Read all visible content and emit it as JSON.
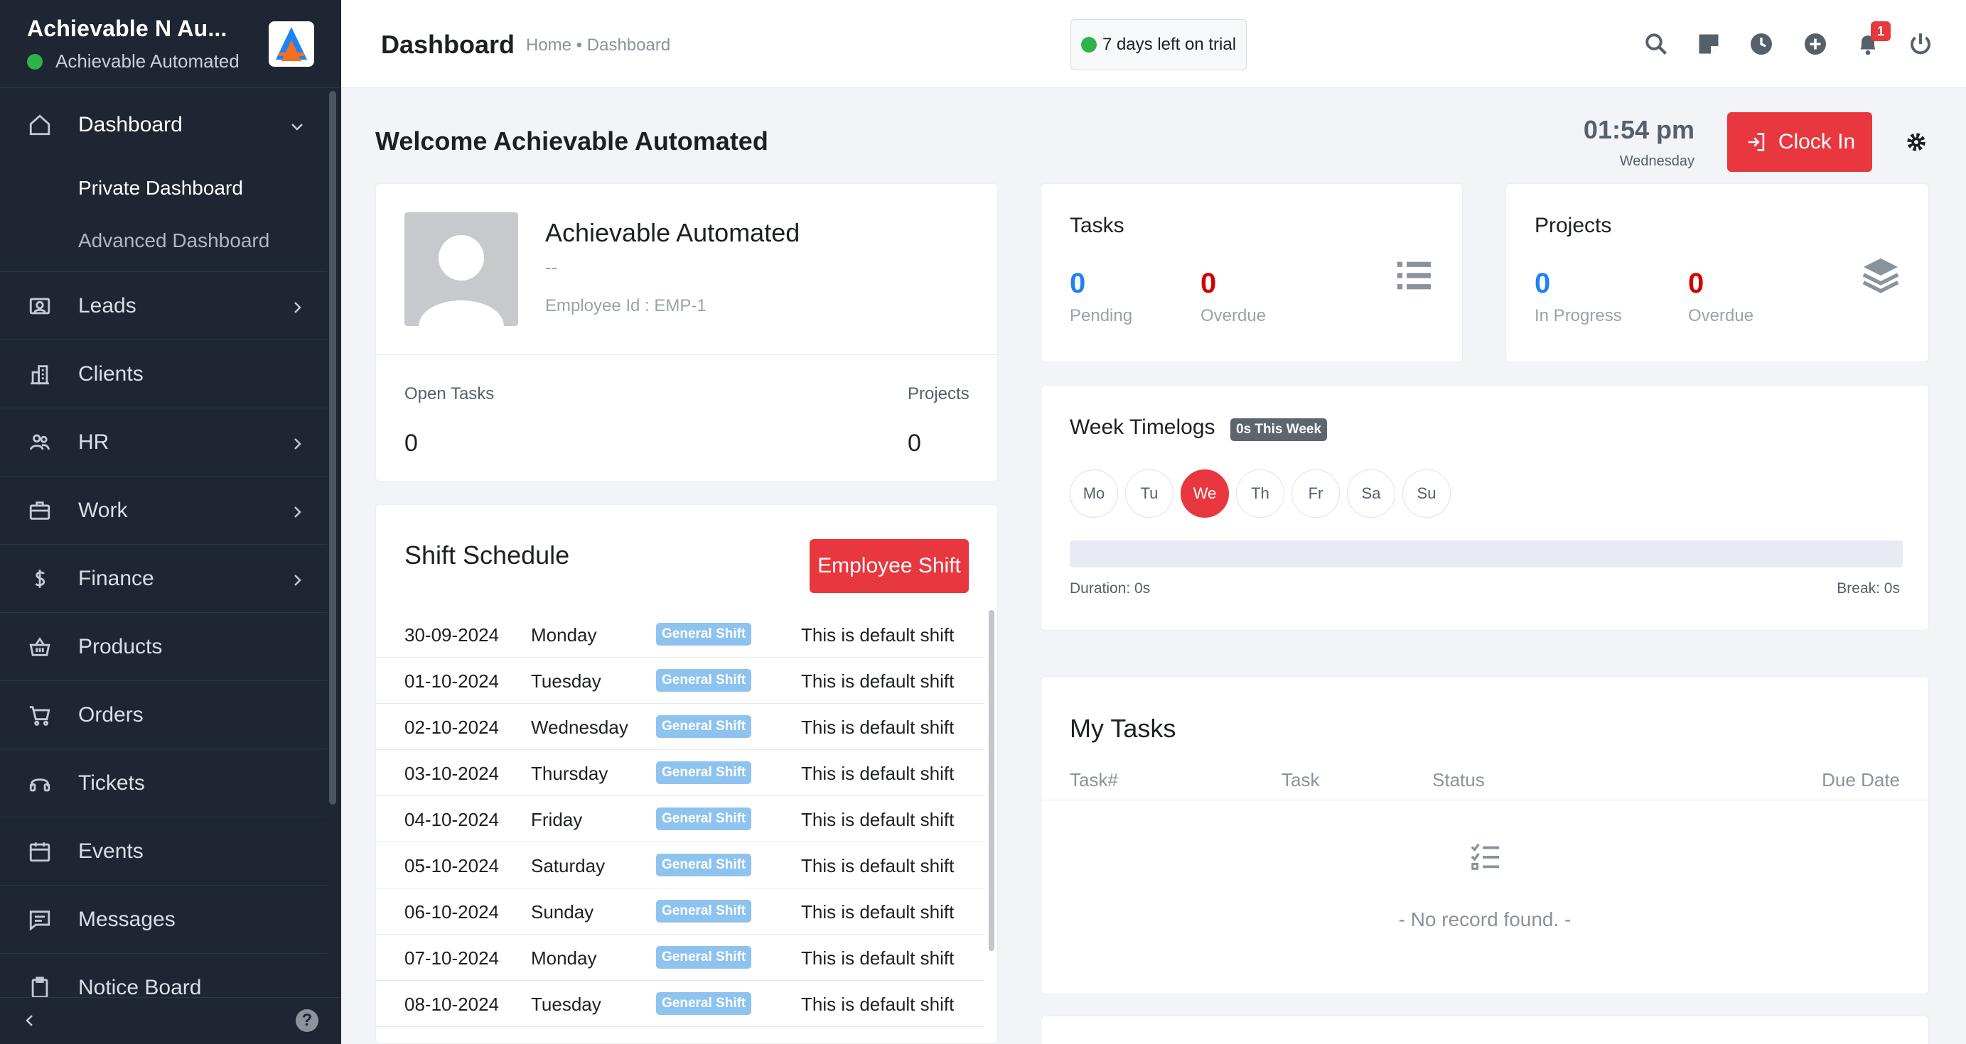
{
  "sidebar": {
    "brand_name": "Achievable N Au...",
    "brand_sub": "Achievable Automated",
    "dashboard_label": "Dashboard",
    "sub_items": [
      "Private Dashboard",
      "Advanced Dashboard"
    ],
    "items": [
      {
        "label": "Leads",
        "icon": "id-card-icon",
        "has_chevron": true
      },
      {
        "label": "Clients",
        "icon": "building-icon",
        "has_chevron": false
      },
      {
        "label": "HR",
        "icon": "people-icon",
        "has_chevron": true
      },
      {
        "label": "Work",
        "icon": "briefcase-icon",
        "has_chevron": true
      },
      {
        "label": "Finance",
        "icon": "dollar-icon",
        "has_chevron": true
      },
      {
        "label": "Products",
        "icon": "basket-icon",
        "has_chevron": false
      },
      {
        "label": "Orders",
        "icon": "cart-icon",
        "has_chevron": false
      },
      {
        "label": "Tickets",
        "icon": "headset-icon",
        "has_chevron": false
      },
      {
        "label": "Events",
        "icon": "calendar-icon",
        "has_chevron": false
      },
      {
        "label": "Messages",
        "icon": "message-icon",
        "has_chevron": false
      },
      {
        "label": "Notice Board",
        "icon": "clipboard-icon",
        "has_chevron": false
      }
    ],
    "help_label": "?"
  },
  "topbar": {
    "title": "Dashboard",
    "breadcrumb": "Home • Dashboard",
    "trial_text": "7 days left on trial",
    "notification_count": "1",
    "icons": [
      "search-icon",
      "sticky-note-icon",
      "clock-icon",
      "plus-circle-icon",
      "bell-icon",
      "power-icon"
    ]
  },
  "welcome": {
    "text": "Welcome Achievable Automated",
    "time": "01:54 pm",
    "day": "Wednesday",
    "clock_in_label": "Clock In"
  },
  "profile": {
    "name": "Achievable Automated",
    "designation": "--",
    "employee_id": "Employee Id : EMP-1",
    "open_tasks_label": "Open Tasks",
    "open_tasks_value": "0",
    "projects_label": "Projects",
    "projects_value": "0"
  },
  "shift_schedule": {
    "title": "Shift Schedule",
    "button_label": "Employee Shift",
    "rows": [
      {
        "date": "30-09-2024",
        "day": "Monday",
        "shift": "General Shift",
        "note": "This is default shift"
      },
      {
        "date": "01-10-2024",
        "day": "Tuesday",
        "shift": "General Shift",
        "note": "This is default shift"
      },
      {
        "date": "02-10-2024",
        "day": "Wednesday",
        "shift": "General Shift",
        "note": "This is default shift"
      },
      {
        "date": "03-10-2024",
        "day": "Thursday",
        "shift": "General Shift",
        "note": "This is default shift"
      },
      {
        "date": "04-10-2024",
        "day": "Friday",
        "shift": "General Shift",
        "note": "This is default shift"
      },
      {
        "date": "05-10-2024",
        "day": "Saturday",
        "shift": "General Shift",
        "note": "This is default shift"
      },
      {
        "date": "06-10-2024",
        "day": "Sunday",
        "shift": "General Shift",
        "note": "This is default shift"
      },
      {
        "date": "07-10-2024",
        "day": "Monday",
        "shift": "General Shift",
        "note": "This is default shift"
      },
      {
        "date": "08-10-2024",
        "day": "Tuesday",
        "shift": "General Shift",
        "note": "This is default shift"
      }
    ]
  },
  "tasks_card": {
    "title": "Tasks",
    "pending_value": "0",
    "pending_label": "Pending",
    "overdue_value": "0",
    "overdue_label": "Overdue"
  },
  "projects_card": {
    "title": "Projects",
    "in_progress_value": "0",
    "in_progress_label": "In Progress",
    "overdue_value": "0",
    "overdue_label": "Overdue"
  },
  "week_timelogs": {
    "title": "Week Timelogs",
    "badge": "0s This Week",
    "days": [
      "Mo",
      "Tu",
      "We",
      "Th",
      "Fr",
      "Sa",
      "Su"
    ],
    "active_day": "We",
    "duration": "Duration: 0s",
    "break": "Break: 0s"
  },
  "my_tasks": {
    "title": "My Tasks",
    "columns": [
      "Task#",
      "Task",
      "Status",
      "Due Date"
    ],
    "empty_text": "- No record found. -"
  },
  "colors": {
    "accent_red": "#e8373e",
    "blue": "#1d82f5",
    "status_green": "#2cb34a",
    "sidebar_bg": "#1d2632"
  }
}
